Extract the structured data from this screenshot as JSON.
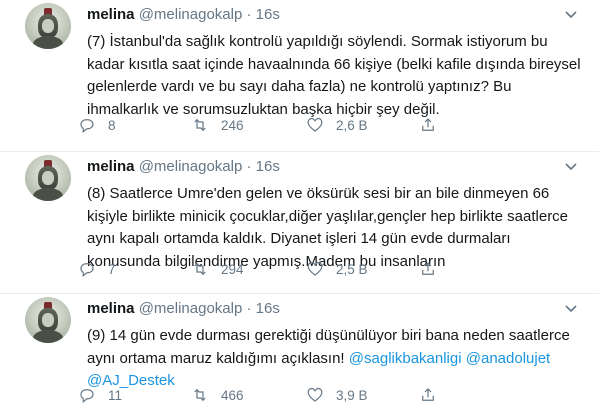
{
  "tweets": [
    {
      "name": "melina",
      "handle": "@melinagokalp",
      "dot": "·",
      "time": "16s",
      "text": "(7) İstanbul'da sağlık kontrolü yapıldığı söylendi. Sormak istiyorum bu kadar kısıtla saat içinde havaalnında 66 kişiye (belki kafile dışında bireysel gelenlerde vardı ve bu sayı daha fazla) ne kontrolü yaptınız? Bu ihmalkarlık ve sorumsuzluktan başka hiçbir şey değil.",
      "replies": "8",
      "retweets": "246",
      "likes": "2,6 B"
    },
    {
      "name": "melina",
      "handle": "@melinagokalp",
      "dot": "·",
      "time": "16s",
      "text": "(8) Saatlerce Umre'den gelen ve öksürük sesi bir an bile dinmeyen 66 kişiyle birlikte minicik çocuklar,diğer yaşlılar,gençler hep birlikte saatlerce aynı kapalı ortamda kaldık. Diyanet işleri 14 gün evde durmaları konusunda bilgilendirme yapmış.Madem bu insanların",
      "replies": "7",
      "retweets": "294",
      "likes": "2,5 B"
    },
    {
      "name": "melina",
      "handle": "@melinagokalp",
      "dot": "·",
      "time": "16s",
      "text_prefix": "(9) 14 gün evde durması gerektiği düşünülüyor biri bana neden saatlerce aynı ortama maruz kaldığımı açıklasın! ",
      "mention1": "@saglikbakanligi",
      "mention2": "@anadolujet",
      "mention3": "@AJ_Destek",
      "replies": "11",
      "retweets": "466",
      "likes": "3,9 B"
    }
  ],
  "icons": {
    "reply": "reply-icon",
    "retweet": "retweet-icon",
    "like": "heart-icon",
    "share": "share-icon",
    "more": "chevron-down-icon"
  },
  "colors": {
    "text": "#14171a",
    "secondary": "#657786",
    "link": "#1b95e0",
    "divider": "#e6ecf0"
  }
}
